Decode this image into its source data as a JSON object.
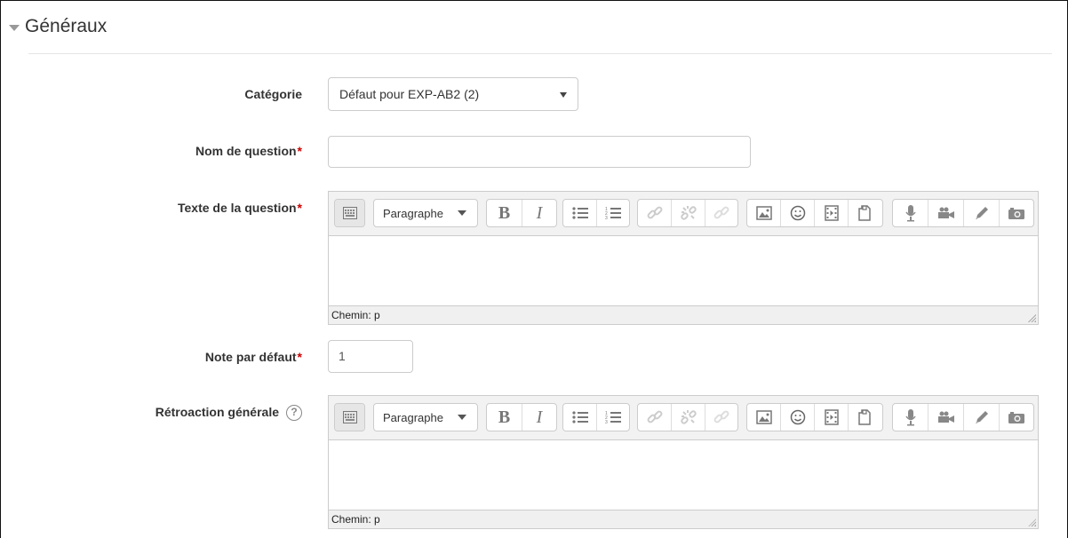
{
  "section": {
    "title": "Généraux"
  },
  "fields": {
    "category": {
      "label": "Catégorie",
      "value": "Défaut pour EXP-AB2 (2)"
    },
    "question_name": {
      "label": "Nom de question",
      "required_mark": "*",
      "value": ""
    },
    "question_text": {
      "label": "Texte de la question",
      "required_mark": "*"
    },
    "default_mark": {
      "label": "Note par défaut",
      "required_mark": "*",
      "value": "1"
    },
    "general_feedback": {
      "label": "Rétroaction générale",
      "help_glyph": "?"
    }
  },
  "editor": {
    "paragraph_label": "Paragraphe",
    "bold_label": "B",
    "italic_label": "I",
    "path_label": "Chemin: p"
  },
  "icons": [
    "show-more-icon",
    "paragraph-format-icon",
    "bold-icon",
    "italic-icon",
    "unordered-list-icon",
    "ordered-list-icon",
    "link-icon",
    "unlink-icon",
    "anchor-link-icon",
    "image-icon",
    "emoticon-icon",
    "media-icon",
    "manage-files-icon",
    "record-audio-icon",
    "record-video-icon",
    "drawing-icon",
    "screenshot-icon"
  ]
}
